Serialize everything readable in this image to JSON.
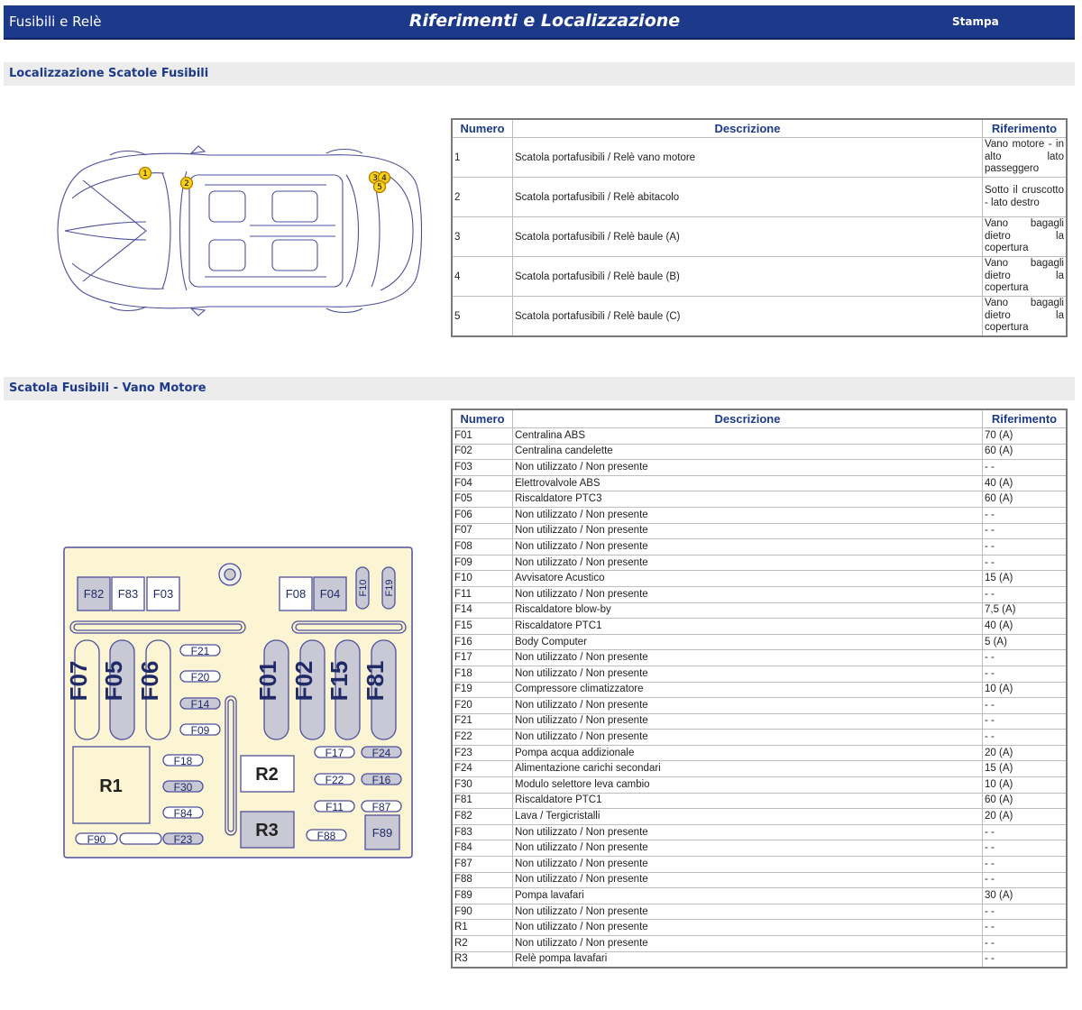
{
  "header": {
    "app_title": "Fusibili e Relè",
    "page_title": "Riferimenti e Localizzazione",
    "print_label": "Stampa"
  },
  "section1": {
    "title": "Localizzazione Scatole Fusibili"
  },
  "section2": {
    "title": "Scatola Fusibili - Vano Motore"
  },
  "table_headers": {
    "numero": "Numero",
    "descrizione": "Descrizione",
    "riferimento": "Riferimento"
  },
  "locations": [
    {
      "numero": "1",
      "descrizione": "Scatola portafusibili / Relè vano motore",
      "riferimento": "Vano motore - in alto lato passeggero"
    },
    {
      "numero": "2",
      "descrizione": "Scatola portafusibili / Relè abitacolo",
      "riferimento": "Sotto il cruscotto - lato destro"
    },
    {
      "numero": "3",
      "descrizione": "Scatola portafusibili / Relè baule (A)",
      "riferimento": "Vano bagagli dietro la copertura"
    },
    {
      "numero": "4",
      "descrizione": "Scatola portafusibili / Relè baule (B)",
      "riferimento": "Vano bagagli dietro la copertura"
    },
    {
      "numero": "5",
      "descrizione": "Scatola portafusibili / Relè baule (C)",
      "riferimento": "Vano bagagli dietro la copertura"
    }
  ],
  "car_markers": [
    "1",
    "2",
    "3",
    "4",
    "5"
  ],
  "fuses": [
    {
      "numero": "F01",
      "descrizione": "Centralina ABS",
      "riferimento": "70 (A)"
    },
    {
      "numero": "F02",
      "descrizione": "Centralina candelette",
      "riferimento": "60 (A)"
    },
    {
      "numero": "F03",
      "descrizione": "Non utilizzato / Non presente",
      "riferimento": "- -"
    },
    {
      "numero": "F04",
      "descrizione": "Elettrovalvole ABS",
      "riferimento": "40 (A)"
    },
    {
      "numero": "F05",
      "descrizione": "Riscaldatore PTC3",
      "riferimento": "60 (A)"
    },
    {
      "numero": "F06",
      "descrizione": "Non utilizzato / Non presente",
      "riferimento": "- -"
    },
    {
      "numero": "F07",
      "descrizione": "Non utilizzato / Non presente",
      "riferimento": "- -"
    },
    {
      "numero": "F08",
      "descrizione": "Non utilizzato / Non presente",
      "riferimento": "- -"
    },
    {
      "numero": "F09",
      "descrizione": "Non utilizzato / Non presente",
      "riferimento": "- -"
    },
    {
      "numero": "F10",
      "descrizione": "Avvisatore Acustico",
      "riferimento": "15 (A)"
    },
    {
      "numero": "F11",
      "descrizione": "Non utilizzato / Non presente",
      "riferimento": "- -"
    },
    {
      "numero": "F14",
      "descrizione": "Riscaldatore blow-by",
      "riferimento": "7,5 (A)"
    },
    {
      "numero": "F15",
      "descrizione": "Riscaldatore PTC1",
      "riferimento": "40 (A)"
    },
    {
      "numero": "F16",
      "descrizione": "Body Computer",
      "riferimento": "5 (A)"
    },
    {
      "numero": "F17",
      "descrizione": "Non utilizzato / Non presente",
      "riferimento": "- -"
    },
    {
      "numero": "F18",
      "descrizione": "Non utilizzato / Non presente",
      "riferimento": "- -"
    },
    {
      "numero": "F19",
      "descrizione": "Compressore climatizzatore",
      "riferimento": "10 (A)"
    },
    {
      "numero": "F20",
      "descrizione": "Non utilizzato / Non presente",
      "riferimento": "- -"
    },
    {
      "numero": "F21",
      "descrizione": "Non utilizzato / Non presente",
      "riferimento": "- -"
    },
    {
      "numero": "F22",
      "descrizione": "Non utilizzato / Non presente",
      "riferimento": "- -"
    },
    {
      "numero": "F23",
      "descrizione": "Pompa acqua addizionale",
      "riferimento": "20 (A)"
    },
    {
      "numero": "F24",
      "descrizione": "Alimentazione carichi secondari",
      "riferimento": "15 (A)"
    },
    {
      "numero": "F30",
      "descrizione": "Modulo selettore leva cambio",
      "riferimento": "10 (A)"
    },
    {
      "numero": "F81",
      "descrizione": "Riscaldatore PTC1",
      "riferimento": "60 (A)"
    },
    {
      "numero": "F82",
      "descrizione": "Lava / Tergicristalli",
      "riferimento": "20 (A)"
    },
    {
      "numero": "F83",
      "descrizione": "Non utilizzato / Non presente",
      "riferimento": "- -"
    },
    {
      "numero": "F84",
      "descrizione": "Non utilizzato / Non presente",
      "riferimento": "- -"
    },
    {
      "numero": "F87",
      "descrizione": "Non utilizzato / Non presente",
      "riferimento": "- -"
    },
    {
      "numero": "F88",
      "descrizione": "Non utilizzato / Non presente",
      "riferimento": "- -"
    },
    {
      "numero": "F89",
      "descrizione": "Pompa lavafari",
      "riferimento": "30 (A)"
    },
    {
      "numero": "F90",
      "descrizione": "Non utilizzato / Non presente",
      "riferimento": "- -"
    },
    {
      "numero": "R1",
      "descrizione": "Non utilizzato / Non presente",
      "riferimento": "- -"
    },
    {
      "numero": "R2",
      "descrizione": "Non utilizzato / Non presente",
      "riferimento": "- -"
    },
    {
      "numero": "R3",
      "descrizione": "Relè pompa lavafari",
      "riferimento": "- -"
    }
  ],
  "fusebox_labels": {
    "f82": "F82",
    "f83": "F83",
    "f03": "F03",
    "f08": "F08",
    "f04": "F04",
    "f10": "F10",
    "f19": "F19",
    "f07": "F07",
    "f05": "F05",
    "f06": "F06",
    "f01": "F01",
    "f02": "F02",
    "f15": "F15",
    "f81": "F81",
    "f21": "F21",
    "f20": "F20",
    "f14": "F14",
    "f09": "F09",
    "f18": "F18",
    "f30": "F30",
    "f84": "F84",
    "f90": "F90",
    "f23": "F23",
    "f17": "F17",
    "f24": "F24",
    "f22": "F22",
    "f16": "F16",
    "f11": "F11",
    "f87": "F87",
    "f88": "F88",
    "f89": "F89",
    "r1": "R1",
    "r2": "R2",
    "r3": "R3"
  },
  "colors": {
    "header_blue": "#1d3a8a",
    "fusebox_bg": "#fbf5d4",
    "marker_yellow": "#f7d117",
    "shaded_fuse": "#c9c9d6"
  }
}
